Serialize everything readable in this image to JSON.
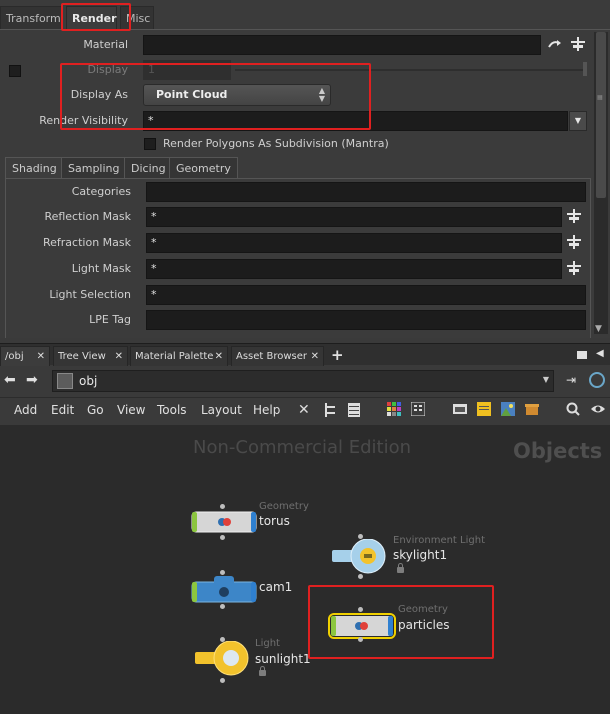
{
  "param_tabs": [
    "Transform",
    "Render",
    "Misc"
  ],
  "params": {
    "material_label": "Material",
    "display_label": "Display",
    "display_value": "1",
    "display_as_label": "Display As",
    "display_as_value": "Point Cloud",
    "render_visibility_label": "Render Visibility",
    "render_visibility_value": "*",
    "render_polygons_label": "Render Polygons As Subdivision (Mantra)"
  },
  "sub_tabs": [
    "Shading",
    "Sampling",
    "Dicing",
    "Geometry"
  ],
  "shading": {
    "categories_label": "Categories",
    "reflection_mask_label": "Reflection Mask",
    "reflection_mask_value": "*",
    "refraction_mask_label": "Refraction Mask",
    "refraction_mask_value": "*",
    "light_mask_label": "Light Mask",
    "light_mask_value": "*",
    "light_selection_label": "Light Selection",
    "light_selection_value": "*",
    "lpe_tag_label": "LPE Tag"
  },
  "pane_tabs": [
    "/obj",
    "Tree View",
    "Material Palette",
    "Asset Browser"
  ],
  "path": "obj",
  "menu": [
    "Add",
    "Edit",
    "Go",
    "View",
    "Tools",
    "Layout",
    "Help"
  ],
  "network": {
    "watermark": "Non-Commercial Edition",
    "context_label": "Objects",
    "nodes": [
      {
        "type": "Geometry",
        "name": "torus"
      },
      {
        "type": "Environment Light",
        "name": "skylight1"
      },
      {
        "type": "",
        "name": "cam1"
      },
      {
        "type": "Geometry",
        "name": "particles"
      },
      {
        "type": "Light",
        "name": "sunlight1"
      }
    ]
  },
  "colors": {
    "highlight": "#e02020",
    "geometry_node": "#d8d8d8",
    "camera_node": "#3d86c8",
    "light_node": "#f2c22c",
    "selected_outline": "#f0d000"
  }
}
